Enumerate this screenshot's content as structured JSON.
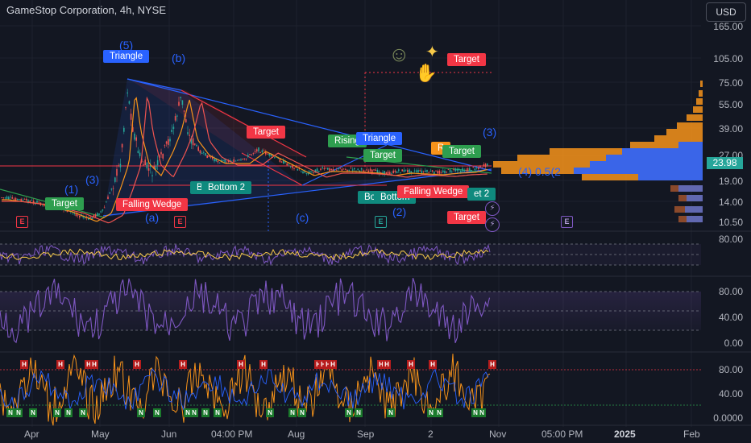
{
  "header": {
    "title": "GameStop Corporation, 4h, NYSE",
    "currency": "USD"
  },
  "price_axis": [
    "165.00",
    "105.00",
    "75.00",
    "55.00",
    "39.00",
    "27.00",
    "19.00",
    "14.00",
    "10.50"
  ],
  "current_price": "23.98",
  "osc1_axis": [
    "80.00"
  ],
  "osc2_axis": [
    "80.00",
    "40.00",
    "0.00"
  ],
  "osc3_axis": [
    "80.00",
    "40.00",
    "0.0000"
  ],
  "time_axis": [
    {
      "label": "Apr",
      "bold": false
    },
    {
      "label": "May",
      "bold": false
    },
    {
      "label": "Jun",
      "bold": false
    },
    {
      "label": "04:00 PM",
      "bold": false
    },
    {
      "label": "Aug",
      "bold": false
    },
    {
      "label": "Sep",
      "bold": false
    },
    {
      "label": "2",
      "bold": false
    },
    {
      "label": "Nov",
      "bold": false
    },
    {
      "label": "05:00 PM",
      "bold": false
    },
    {
      "label": "2025",
      "bold": true
    },
    {
      "label": "Feb",
      "bold": false
    }
  ],
  "pattern_labels": [
    {
      "text": "Triangle",
      "color": "blue"
    },
    {
      "text": "Target",
      "color": "red"
    },
    {
      "text": "Target",
      "color": "red"
    },
    {
      "text": "Target",
      "color": "green"
    },
    {
      "text": "Falling Wedge",
      "color": "red"
    },
    {
      "text": "B",
      "color": "teal"
    },
    {
      "text": "Bottom 2",
      "color": "teal"
    },
    {
      "text": "Rising",
      "color": "green"
    },
    {
      "text": "Triangle",
      "color": "blue"
    },
    {
      "text": "Target",
      "color": "green"
    },
    {
      "text": "R",
      "color": "orange"
    },
    {
      "text": "Target",
      "color": "green"
    },
    {
      "text": "Bo",
      "color": "teal"
    },
    {
      "text": "Bottom",
      "color": "teal"
    },
    {
      "text": "Falling Wedge",
      "color": "red"
    },
    {
      "text": "et 2",
      "color": "teal"
    },
    {
      "text": "Target",
      "color": "red"
    }
  ],
  "wave_labels": [
    "(5)",
    "(b)",
    "(1)",
    "(3)",
    "(a)",
    "(c)",
    "(2)",
    "(3)",
    "(4) 0.5(2"
  ],
  "earnings_badge": "E",
  "hn_markers": {
    "h": "H",
    "n": "N"
  },
  "emojis": {
    "smiley": "☺",
    "sparkle": "✦",
    "hand": "✋"
  },
  "colors": {
    "background": "#131722",
    "up": "#26a69a",
    "down": "#ef5350",
    "accent": "#2962ff",
    "oscillator": "#7e57c2",
    "volume_up": "#2962ff",
    "volume_down": "#f7931a"
  }
}
